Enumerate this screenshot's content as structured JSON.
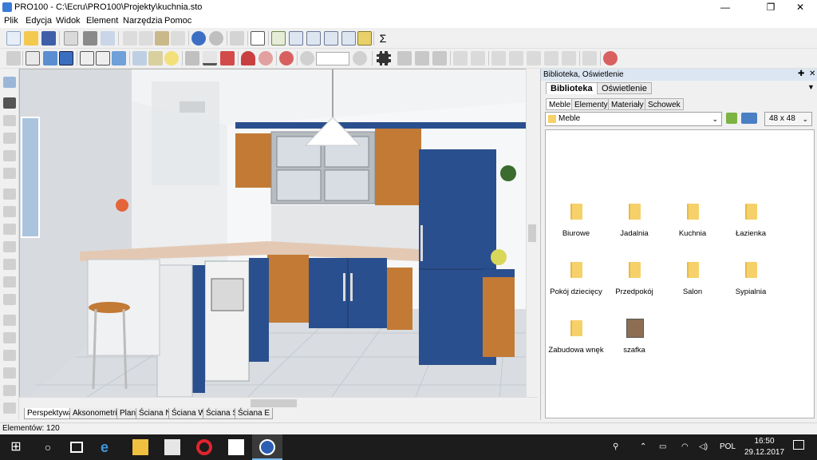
{
  "window": {
    "title": "PRO100 - C:\\Ecru\\PRO100\\Projekty\\kuchnia.sto",
    "minimize": "—",
    "maximize": "❐",
    "close": "✕"
  },
  "menu": [
    "Plik",
    "Edycja",
    "Widok",
    "Element",
    "Narzędzia",
    "Pomoc"
  ],
  "toolbar": {
    "zoom_value": ""
  },
  "view_tabs": [
    "Perspektywa",
    "Aksonometria",
    "Plan",
    "Ściana N",
    "Ściana W",
    "Ściana S",
    "Ściana E"
  ],
  "active_view_tab": "Perspektywa",
  "panel": {
    "title": "Biblioteka, Oświetlenie",
    "tabs": [
      "Biblioteka",
      "Oświetlenie"
    ],
    "sub_tabs": [
      "Meble",
      "Elementy",
      "Materiały",
      "Schowek"
    ],
    "folder": "Meble",
    "icon_size": "48 x 48",
    "items": [
      {
        "label": "Biurowe",
        "icon": "folder-icon"
      },
      {
        "label": "Jadalnia",
        "icon": "folder-icon"
      },
      {
        "label": "Kuchnia",
        "icon": "folder-icon"
      },
      {
        "label": "Łazienka",
        "icon": "folder-icon"
      },
      {
        "label": "Pokój dziecięcy",
        "icon": "folder-icon"
      },
      {
        "label": "Przedpokój",
        "icon": "folder-icon"
      },
      {
        "label": "Salon",
        "icon": "folder-icon"
      },
      {
        "label": "Sypialnia",
        "icon": "folder-icon"
      },
      {
        "label": "Zabudowa wnęk",
        "icon": "folder-icon"
      },
      {
        "label": "szafka",
        "icon": "cabinet-icon"
      }
    ]
  },
  "status": {
    "elements": "Elementów: 120"
  },
  "taskbar": {
    "language": "POL",
    "time": "16:50",
    "date": "29.12.2017"
  },
  "colors": {
    "cabinet_blue": "#2a4f8e",
    "cabinet_wood": "#c27a35",
    "folder_yellow": "#f6d16a"
  }
}
